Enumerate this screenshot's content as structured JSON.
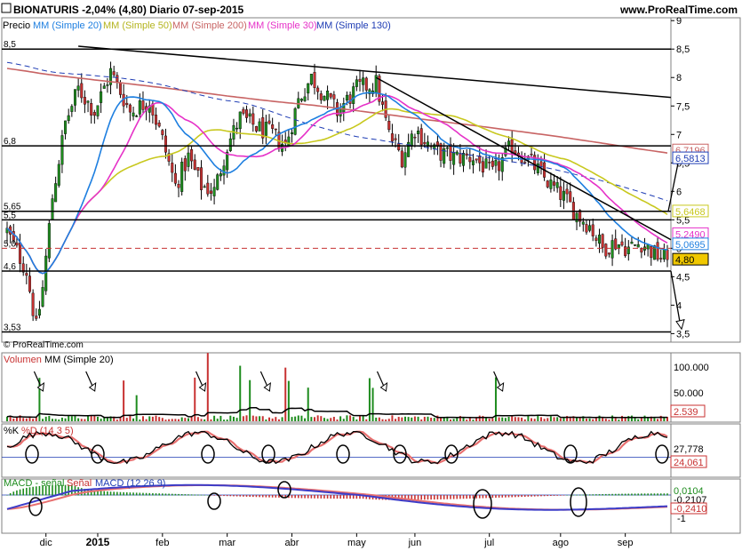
{
  "header": {
    "ticker_line": "BIONATURIS   -2,04% (4,80)   Diario   07-sep-2015",
    "site": "www.ProRealTime.com",
    "copyright": "© ProRealTime.com"
  },
  "legend": {
    "price": "Precio",
    "ma20": "MM (Simple 20)",
    "ma50": "MM (Simple 50)",
    "ma200": "MM (Simple 200)",
    "ma30": "MM (Simple 30)",
    "ma130": "MM (Simple 130)",
    "volume": "Volumen",
    "vol_ma": "MM (Simple 20)",
    "stoch_k": "%K",
    "stoch_d": "%D (14 3 5)",
    "macd_signal_hist": "MACD - señal",
    "macd_signal": "Señal",
    "macd": "MACD (12 26 9)"
  },
  "colors": {
    "ma20": "#1e7fe0",
    "ma50": "#c8c81e",
    "ma200": "#c86464",
    "ma30": "#e632c8",
    "ma130": "#1e3cb4",
    "up": "#1e8c1e",
    "down": "#c83232",
    "line": "#000000"
  },
  "chart_data": [
    {
      "type": "candlestick",
      "ylim": [
        3.35,
        9.05
      ],
      "yticks": [
        "9",
        "8,5",
        "8",
        "7,5",
        "7",
        "6,5",
        "6",
        "5,5",
        "5",
        "4,5",
        "4",
        "3,5"
      ],
      "ytick_values": [
        9,
        8.5,
        8,
        7.5,
        7,
        6.5,
        6,
        5.5,
        5,
        4.5,
        4,
        3.5
      ],
      "x_labels": [
        "dic",
        "2015",
        "feb",
        "mar",
        "abr",
        "may",
        "jun",
        "jul",
        "ago",
        "sep"
      ],
      "left_level_labels": [
        {
          "text": "8,5",
          "value": 8.5
        },
        {
          "text": "6,8",
          "value": 6.8
        },
        {
          "text": "5,65",
          "value": 5.65
        },
        {
          "text": "5,5",
          "value": 5.5
        },
        {
          "text": "5,0",
          "value": 5.0
        },
        {
          "text": "4,6",
          "value": 4.6
        },
        {
          "text": "3,53",
          "value": 3.53
        }
      ],
      "last_values": [
        {
          "label": "6,7196",
          "value": 6.7196,
          "color": "#c86464"
        },
        {
          "label": "6,5813",
          "value": 6.5813,
          "color": "#1e3cb4"
        },
        {
          "label": "5,6468",
          "value": 5.6468,
          "color": "#c8c81e"
        },
        {
          "label": "5,2490",
          "value": 5.249,
          "color": "#e632c8"
        },
        {
          "label": "5,0695",
          "value": 5.0695,
          "color": "#1e7fe0"
        },
        {
          "label": "4,80",
          "value": 4.8,
          "color": "#000000"
        }
      ]
    },
    {
      "type": "bar",
      "name": "volume",
      "yticks": [
        "100.000",
        "50.000"
      ],
      "ytick_values": [
        100000,
        50000
      ],
      "last_value": "2.539"
    },
    {
      "type": "line",
      "name": "stochastic",
      "last_values": [
        "27,778",
        "24,061"
      ]
    },
    {
      "type": "line",
      "name": "macd",
      "yticks": [
        "-1"
      ],
      "last_values": [
        "0,0104",
        "-0,2107",
        "-0,2410"
      ]
    }
  ]
}
